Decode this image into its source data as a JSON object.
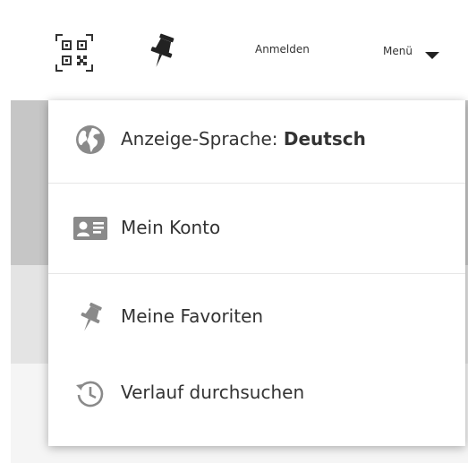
{
  "header": {
    "qr_icon": "qr-code-icon",
    "pin_icon": "pushpin-icon",
    "login_label": "Anmelden",
    "menu_label": "Menü",
    "menu_caret_icon": "caret-down-icon"
  },
  "dropdown": {
    "items": [
      {
        "label": "Anzeige-Sprache: ",
        "value": "Deutsch",
        "icon": "globe-icon"
      },
      {
        "label": "Mein Konto",
        "icon": "id-card-icon"
      },
      {
        "label": "Meine Favoriten",
        "icon": "pushpin-icon"
      },
      {
        "label": "Verlauf durchsuchen",
        "icon": "history-icon"
      }
    ]
  },
  "colors": {
    "text": "#333333",
    "icon": "#8a8a8a",
    "divider": "#e6e6e6",
    "backdrop_dark": "#c6c6c6",
    "backdrop_mid": "#e4e4e4",
    "backdrop_light": "#f5f5f5"
  }
}
